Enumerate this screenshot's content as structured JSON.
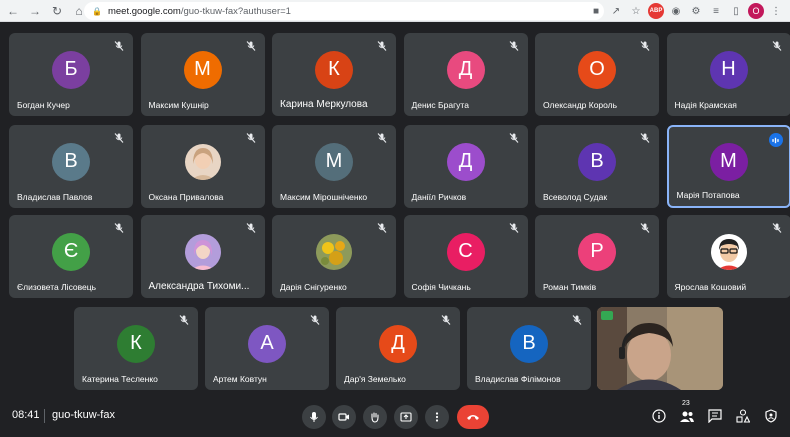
{
  "browser": {
    "url_host": "meet.google.com",
    "url_path": "/guo-tkuw-fax?authuser=1",
    "profile_initial": "O"
  },
  "tiles": [
    {
      "name": "Богдан Кучер",
      "initial": "Б",
      "color": "#7b3fa0",
      "type": "letter"
    },
    {
      "name": "Максим Кушнір",
      "initial": "М",
      "color": "#ef6c00",
      "type": "letter"
    },
    {
      "name": "Карина Меркулова",
      "initial": "К",
      "color": "#d84315",
      "type": "letter"
    },
    {
      "name": "Денис Брагута",
      "initial": "Д",
      "color": "#e84a7f",
      "type": "letter"
    },
    {
      "name": "Олександр Король",
      "initial": "О",
      "color": "#e64a19",
      "type": "letter"
    },
    {
      "name": "Надія Крамская",
      "initial": "Н",
      "color": "#5e35b1",
      "type": "letter"
    },
    {
      "name": "Владислав Павлов",
      "initial": "В",
      "color": "#5a7a8a",
      "type": "letter"
    },
    {
      "name": "Оксана Привалова",
      "initial": "",
      "color": "#c9a27e",
      "type": "photo"
    },
    {
      "name": "Максим Мірошніченко",
      "initial": "М",
      "color": "#546e7a",
      "type": "letter"
    },
    {
      "name": "Даніїл Ричков",
      "initial": "Д",
      "color": "#9c4dcc",
      "type": "letter"
    },
    {
      "name": "Всеволод Судак",
      "initial": "В",
      "color": "#5e35b1",
      "type": "letter"
    },
    {
      "name": "Марія Потапова",
      "initial": "М",
      "color": "#7b1fa2",
      "type": "letter"
    },
    {
      "name": "Єлизовета Лісовець",
      "initial": "Є",
      "color": "#43a047",
      "type": "letter"
    },
    {
      "name": "Александра Тихоми...",
      "initial": "",
      "color": "#b39ddb",
      "type": "photo"
    },
    {
      "name": "Дарія Снігуренко",
      "initial": "",
      "color": "#c5a64a",
      "type": "photo"
    },
    {
      "name": "Софія Чичкань",
      "initial": "С",
      "color": "#e91e63",
      "type": "letter"
    },
    {
      "name": "Роман Тимків",
      "initial": "Р",
      "color": "#ec407a",
      "type": "letter"
    },
    {
      "name": "Ярослав Кошовий",
      "initial": "",
      "color": "#ffffff",
      "type": "photo"
    },
    {
      "name": "Катерина Тесленко",
      "initial": "К",
      "color": "#2e7d32",
      "type": "letter"
    },
    {
      "name": "Артем Ковтун",
      "initial": "А",
      "color": "#7e57c2",
      "type": "letter"
    },
    {
      "name": "Дар'я Земелько",
      "initial": "Д",
      "color": "#e64a19",
      "type": "letter"
    },
    {
      "name": "Владислав Філімонов",
      "initial": "В",
      "color": "#1565c0",
      "type": "letter"
    }
  ],
  "meeting": {
    "time": "08:41",
    "code": "guo-tkuw-fax",
    "participants_count": "23"
  },
  "colors": {
    "background": "#202124",
    "tile": "#3c4043",
    "hangup": "#ea4335",
    "active_border": "#8ab4f8"
  }
}
